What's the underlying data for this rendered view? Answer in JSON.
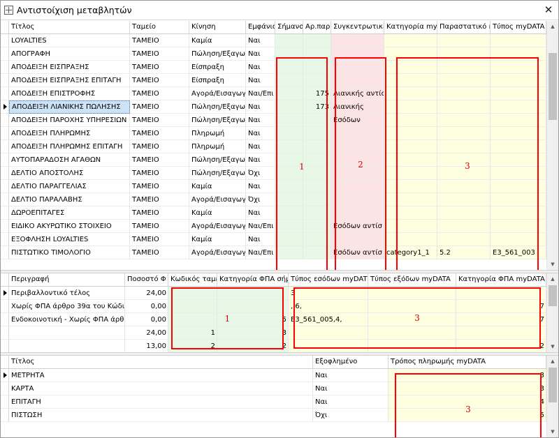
{
  "window": {
    "title": "Αντιστοίχιση μεταβλητών",
    "close_glyph": "✕"
  },
  "grid1": {
    "columns": [
      "Τίτλος",
      "Ταμείο",
      "Κίνηση",
      "Εμφάνισ",
      "Σήμανσ",
      "Αρ.παρ",
      "Συγκεντρωτικέ",
      "Κατηγορία myD",
      "Παραστατικό m",
      "Τύπος myDATA"
    ],
    "rows": [
      [
        "LOYALTIES",
        "ΤΑΜΕΙΟ",
        "Καμία",
        "Ναι",
        "",
        "",
        "",
        "",
        "",
        ""
      ],
      [
        "ΑΠΟΓΡΑΦΗ",
        "ΤΑΜΕΙΟ",
        "Πώληση/Εξαγωγ",
        "Ναι",
        "",
        "",
        "",
        "",
        "",
        ""
      ],
      [
        "ΑΠΟΔΕΙΞΗ ΕΙΣΠΡΑΞΗΣ",
        "ΤΑΜΕΙΟ",
        "Είσπραξη",
        "Ναι",
        "",
        "",
        "",
        "",
        "",
        ""
      ],
      [
        "ΑΠΟΔΕΙΞΗ ΕΙΣΠΡΑΞΗΣ ΕΠΙΤΑΓΗ",
        "ΤΑΜΕΙΟ",
        "Είσπραξη",
        "Ναι",
        "",
        "",
        "",
        "",
        "",
        ""
      ],
      [
        "ΑΠΟΔΕΙΞΗ ΕΠΙΣΤΡΟΦΗΣ",
        "ΤΑΜΕΙΟ",
        "Αγορά/Εισαγωγ",
        "Ναι/Επι",
        "",
        "175",
        "Λιανικής αντίσ",
        "",
        "",
        ""
      ],
      [
        "ΑΠΟΔΕΙΞΗ ΛΙΑΝΙΚΗΣ ΠΩΛΗΣΗΣ",
        "ΤΑΜΕΙΟ",
        "Πώληση/Εξαγωγ",
        "Ναι",
        "",
        "173",
        "Λιανικής",
        "",
        "",
        ""
      ],
      [
        "ΑΠΟΔΕΙΞΗ ΠΑΡΟΧΗΣ ΥΠΗΡΕΣΙΩΝ",
        "ΤΑΜΕΙΟ",
        "Πώληση/Εξαγωγ",
        "Ναι",
        "",
        "",
        "Εσόδων",
        "",
        "",
        ""
      ],
      [
        "ΑΠΟΔΕΙΞΗ ΠΛΗΡΩΜΗΣ",
        "ΤΑΜΕΙΟ",
        "Πληρωμή",
        "Ναι",
        "",
        "",
        "",
        "",
        "",
        ""
      ],
      [
        "ΑΠΟΔΕΙΞΗ ΠΛΗΡΩΜΗΣ ΕΠΙΤΑΓΗ",
        "ΤΑΜΕΙΟ",
        "Πληρωμή",
        "Ναι",
        "",
        "",
        "",
        "",
        "",
        ""
      ],
      [
        "ΑΥΤΟΠΑΡΑΔΟΣΗ ΑΓΑΘΩΝ",
        "ΤΑΜΕΙΟ",
        "Πώληση/Εξαγωγ",
        "Ναι",
        "",
        "",
        "",
        "",
        "",
        ""
      ],
      [
        "ΔΕΛΤΙΟ ΑΠΟΣΤΟΛΗΣ",
        "ΤΑΜΕΙΟ",
        "Πώληση/Εξαγωγ",
        "Όχι",
        "",
        "",
        "",
        "",
        "",
        ""
      ],
      [
        "ΔΕΛΤΙΟ ΠΑΡΑΓΓΕΛΙΑΣ",
        "ΤΑΜΕΙΟ",
        "Καμία",
        "Ναι",
        "",
        "",
        "",
        "",
        "",
        ""
      ],
      [
        "ΔΕΛΤΙΟ ΠΑΡΑΛΑΒΗΣ",
        "ΤΑΜΕΙΟ",
        "Αγορά/Εισαγωγ",
        "Όχι",
        "",
        "",
        "",
        "",
        "",
        ""
      ],
      [
        "ΔΩΡΟΕΠΙΤΑΓΕΣ",
        "ΤΑΜΕΙΟ",
        "Καμία",
        "Ναι",
        "",
        "",
        "",
        "",
        "",
        ""
      ],
      [
        "ΕΙΔΙΚΟ ΑΚΥΡΩΤΙΚΟ ΣΤΟΙΧΕΙΟ",
        "ΤΑΜΕΙΟ",
        "Αγορά/Εισαγωγ",
        "Ναι/Επι",
        "",
        "",
        "Εσόδων αντίσ",
        "",
        "",
        ""
      ],
      [
        "ΕΞΟΦΛΗΣΗ LOYALTIES",
        "ΤΑΜΕΙΟ",
        "Καμία",
        "Ναι",
        "",
        "",
        "",
        "",
        "",
        ""
      ],
      [
        "ΠΙΣΤΩΤΙΚΟ ΤΙΜΟΛΟΓΙΟ",
        "ΤΑΜΕΙΟ",
        "Αγορά/Εισαγωγ",
        "Ναι/Επι",
        "",
        "",
        "Εσόδων αντίσ",
        "category1_1",
        "5.2",
        "E3_561_003"
      ]
    ],
    "marks": [
      "1",
      "2",
      "3"
    ]
  },
  "grid2": {
    "columns": [
      "Περιγραφή",
      "Ποσοστό Φ",
      "Κωδικός ταμεί",
      "Κατηγορία ΦΠΑ σήμ",
      "Τύπος εσόδων myDAT",
      "Τύπος εξόδων myDATA",
      "Κατηγορία ΦΠΑ myDATA"
    ],
    "rows": [
      [
        "Περιβαλλοντικό τέλος",
        "24,00",
        "",
        "",
        "3",
        "",
        ""
      ],
      [
        "Χωρίς ΦΠΑ άρθρο 39α του Κώδικα",
        "0,00",
        "",
        "",
        ", 6,",
        "",
        "7"
      ],
      [
        "Ενδοκοινοτική - Χωρίς ΦΠΑ άρθρο",
        "0,00",
        "",
        "5",
        "E3_561_005,4,",
        "",
        "7"
      ],
      [
        "",
        "24,00",
        "1",
        "3",
        "",
        "",
        ""
      ],
      [
        "",
        "13,00",
        "2",
        "2",
        "",
        "",
        "2"
      ]
    ],
    "marks": [
      "1",
      "3"
    ]
  },
  "grid3": {
    "columns": [
      "Τίτλος",
      "Εξοφλημένο",
      "Τρόπος πληρωμής myDATA"
    ],
    "rows": [
      [
        "ΜΕΤΡΗΤΑ",
        "Ναι",
        "3"
      ],
      [
        "ΚΑΡΤΑ",
        "Ναι",
        "3"
      ],
      [
        "ΕΠΙΤΑΓΗ",
        "Ναι",
        "4"
      ],
      [
        "ΠΙΣΤΩΣΗ",
        "Όχι",
        "5"
      ]
    ],
    "marks": [
      "3"
    ]
  },
  "colors": {
    "green_cell": "#e7f8e7",
    "pink_cell": "#fde4e4",
    "yellow_cell": "#fefee0",
    "highlight": "#ff0000",
    "selection": "#cce3f7"
  }
}
